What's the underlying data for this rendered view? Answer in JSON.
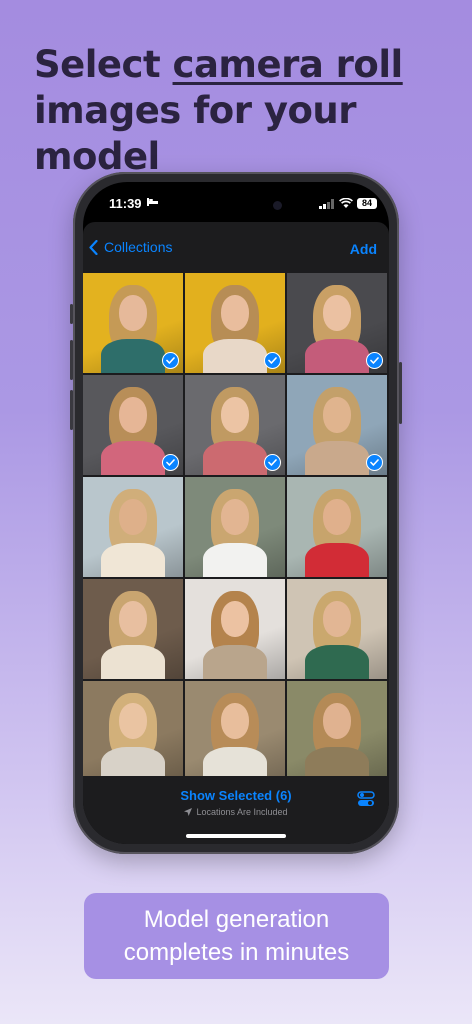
{
  "headline": {
    "line1_pre": "Select ",
    "line1_underlined": "camera roll",
    "line2": "images for your model"
  },
  "status_bar": {
    "time": "11:39",
    "battery": "84"
  },
  "nav": {
    "back_label": "Collections",
    "add_label": "Add"
  },
  "photos": [
    {
      "selected": true,
      "bg": "#e3b21f",
      "hair": "#c59a56",
      "skin": "#e6b99a",
      "top": "#2e6e6a"
    },
    {
      "selected": true,
      "bg": "#e2b01e",
      "hair": "#b78d55",
      "skin": "#e9bd9d",
      "top": "#e8d8c8"
    },
    {
      "selected": true,
      "bg": "#4a4a4e",
      "hair": "#c9a065",
      "skin": "#ebc1a2",
      "top": "#c45c7a"
    },
    {
      "selected": true,
      "bg": "#58585c",
      "hair": "#b88e58",
      "skin": "#e6b696",
      "top": "#d2667c"
    },
    {
      "selected": true,
      "bg": "#6a6a6e",
      "hair": "#c09a62",
      "skin": "#ecc4a4",
      "top": "#cc6a70"
    },
    {
      "selected": true,
      "bg": "#8fa6b8",
      "hair": "#c3a06a",
      "skin": "#e0b48e",
      "top": "#c9a98c"
    },
    {
      "selected": false,
      "bg": "#b9c6cc",
      "hair": "#d0ae7a",
      "skin": "#deb08a",
      "top": "#f0e6d6"
    },
    {
      "selected": false,
      "bg": "#7e8a7a",
      "hair": "#caa670",
      "skin": "#e2b592",
      "top": "#f2f2f0"
    },
    {
      "selected": false,
      "bg": "#a9b6b2",
      "hair": "#c7a46c",
      "skin": "#e0b08c",
      "top": "#d22c36"
    },
    {
      "selected": false,
      "bg": "#6e5c4c",
      "hair": "#c9a570",
      "skin": "#e8bfa0",
      "top": "#ece2d2"
    },
    {
      "selected": false,
      "bg": "#e4e0dc",
      "hair": "#b4834c",
      "skin": "#ecc2a2",
      "top": "#b9a58c"
    },
    {
      "selected": false,
      "bg": "#cfc4b4",
      "hair": "#caa86e",
      "skin": "#e2b694",
      "top": "#2f6a50"
    },
    {
      "selected": false,
      "bg": "#8c7a60",
      "hair": "#d2b07a",
      "skin": "#eac4a2",
      "top": "#d8d2c8"
    },
    {
      "selected": false,
      "bg": "#9a8a70",
      "hair": "#b88c58",
      "skin": "#e8be9c",
      "top": "#e6e2d8"
    },
    {
      "selected": false,
      "bg": "#8a8a68",
      "hair": "#b48a56",
      "skin": "#e0b290",
      "top": "#8e7c5a"
    }
  ],
  "footer": {
    "show_selected": "Show Selected (6)",
    "locations": "Locations Are Included"
  },
  "cta": {
    "line1": "Model generation",
    "line2": "completes in minutes"
  }
}
